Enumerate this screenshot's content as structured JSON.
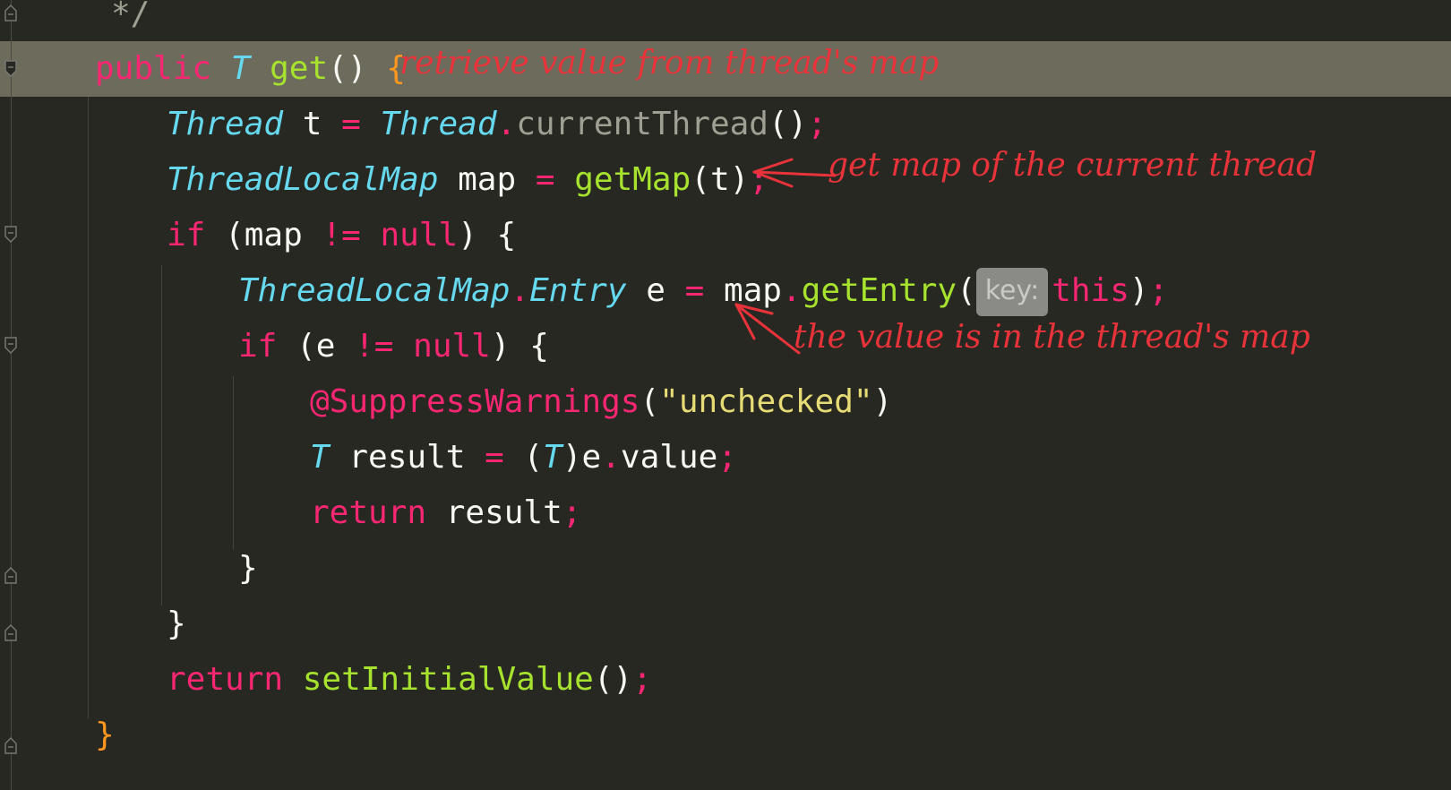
{
  "editor": {
    "comment_end": "*/",
    "line1": {
      "kw": "public",
      "type": "T",
      "fn": "get",
      "parens": "()",
      "brace": "{"
    },
    "line2": {
      "type1": "Thread",
      "var": "t",
      "eq": "=",
      "type2": "Thread",
      "dot": ".",
      "method": "currentThread",
      "tail": "()",
      "semi": ";"
    },
    "line3": {
      "type": "ThreadLocalMap",
      "var": "map",
      "eq": "=",
      "fn": "getMap",
      "args": "(t)",
      "semi": ";"
    },
    "line4": {
      "kw": "if",
      "open": "(map",
      "op": "!=",
      "nul": "null",
      "close": ") {"
    },
    "line5": {
      "type1": "ThreadLocalMap",
      "dot": ".",
      "type2": "Entry",
      "var": "e",
      "eq": "=",
      "obj": "map",
      "dot2": ".",
      "fn": "getEntry",
      "open": "(",
      "hint": "key:",
      "arg": "this",
      "close": ")",
      "semi": ";"
    },
    "line6": {
      "kw": "if",
      "open": "(e",
      "op": "!=",
      "nul": "null",
      "close": ") {"
    },
    "line7": {
      "ann": "@SuppressWarnings",
      "open": "(",
      "str": "\"unchecked\"",
      "close": ")"
    },
    "line8": {
      "type": "T",
      "var": "result",
      "eq": "=",
      "open": "(",
      "cast": "T",
      "close": ")e",
      "dot": ".",
      "field": "value",
      "semi": ";"
    },
    "line9": {
      "kw": "return",
      "var": "result",
      "semi": ";"
    },
    "line10": {
      "brace": "}"
    },
    "line11": {
      "brace": "}"
    },
    "line12": {
      "kw": "return",
      "fn": "setInitialValue",
      "tail": "()",
      "semi": ";"
    },
    "line13": {
      "brace": "}"
    }
  },
  "annotations": {
    "note1": "retrieve value from thread's map",
    "note2": "get map of the current thread",
    "note3": "the value is in the thread's map"
  },
  "colors": {
    "background": "#272822",
    "highlight": "#6c6b5c",
    "annotation": "#e8333a"
  }
}
